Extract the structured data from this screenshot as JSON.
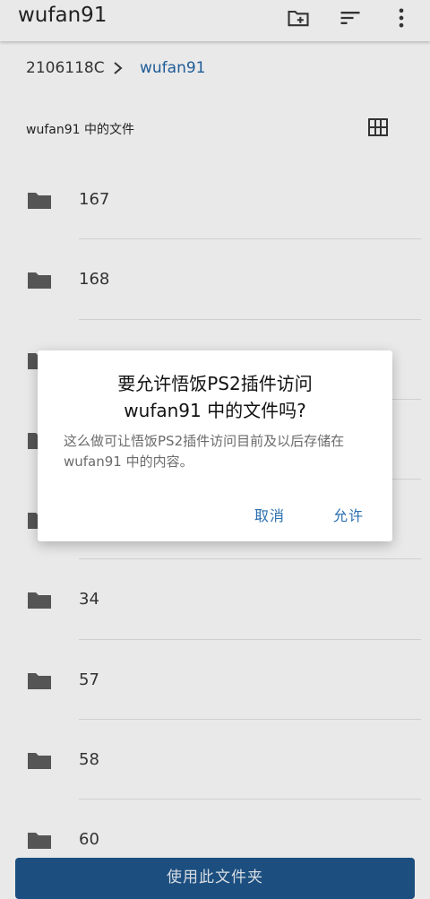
{
  "appbar": {
    "title": "wufan91",
    "icons": [
      "new-folder-icon",
      "sort-icon",
      "more-vert-icon"
    ]
  },
  "breadcrumb": {
    "root": "2106118C",
    "current": "wufan91",
    "separator_icon": "chevron-right-icon"
  },
  "section": {
    "title": "wufan91 中的文件",
    "view_icon": "grid-view-icon"
  },
  "folders": [
    {
      "name": "167"
    },
    {
      "name": "168"
    },
    {
      "name": ""
    },
    {
      "name": ""
    },
    {
      "name": ""
    },
    {
      "name": "34"
    },
    {
      "name": "57"
    },
    {
      "name": "58"
    },
    {
      "name": "60"
    }
  ],
  "bottom_button": {
    "label": "使用此文件夹"
  },
  "dialog": {
    "title": "要允许悟饭PS2插件访问\nwufan91 中的文件吗?",
    "message": "这么做可让悟饭PS2插件访问目前及以后存储在 wufan91 中的内容。",
    "cancel_label": "取消",
    "allow_label": "允许"
  },
  "colors": {
    "accent": "#1e5c97",
    "button_bg": "#1c4f80",
    "dialog_button": "#2a6fb0",
    "background": "#e9e9e9"
  }
}
